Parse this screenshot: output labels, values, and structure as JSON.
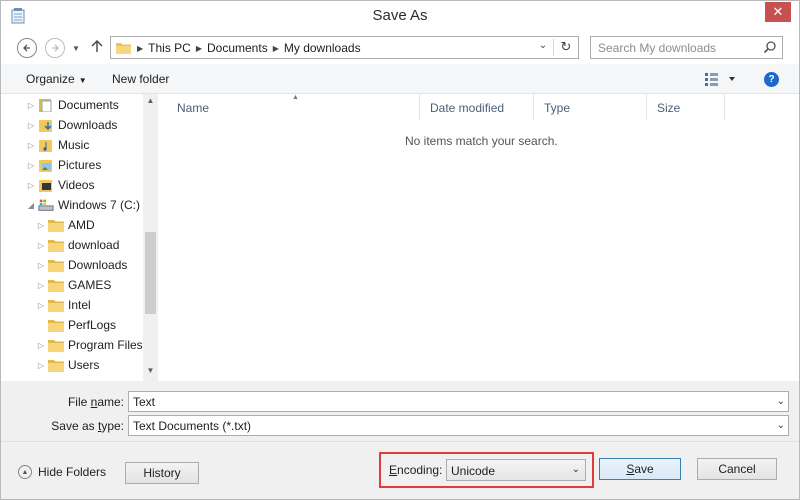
{
  "window": {
    "title": "Save As",
    "close": "✕"
  },
  "nav": {
    "crumbs": [
      "This PC",
      "Documents",
      "My downloads"
    ],
    "search_placeholder": "Search My downloads"
  },
  "toolbar": {
    "organize": "Organize",
    "new_folder": "New folder",
    "help": "?"
  },
  "tree": [
    {
      "label": "Documents",
      "arrow": "▷",
      "icon": "documents-icon"
    },
    {
      "label": "Downloads",
      "arrow": "▷",
      "icon": "downloads-icon"
    },
    {
      "label": "Music",
      "arrow": "▷",
      "icon": "music-icon"
    },
    {
      "label": "Pictures",
      "arrow": "▷",
      "icon": "pictures-icon"
    },
    {
      "label": "Videos",
      "arrow": "▷",
      "icon": "videos-icon"
    },
    {
      "label": "Windows 7 (C:)",
      "arrow": "◢",
      "icon": "drive-icon"
    },
    {
      "label": "AMD",
      "arrow": "▷",
      "icon": "folder-icon"
    },
    {
      "label": "download",
      "arrow": "▷",
      "icon": "folder-icon"
    },
    {
      "label": "Downloads",
      "arrow": "▷",
      "icon": "folder-icon"
    },
    {
      "label": "GAMES",
      "arrow": "▷",
      "icon": "folder-icon"
    },
    {
      "label": "Intel",
      "arrow": "▷",
      "icon": "folder-icon"
    },
    {
      "label": "PerfLogs",
      "arrow": "",
      "icon": "folder-icon"
    },
    {
      "label": "Program Files",
      "arrow": "▷",
      "icon": "folder-icon"
    },
    {
      "label": "Users",
      "arrow": "▷",
      "icon": "folder-icon"
    }
  ],
  "columns": [
    "Name",
    "Date modified",
    "Type",
    "Size"
  ],
  "empty_message": "No items match your search.",
  "form": {
    "filename_label_pre": "File ",
    "filename_label_ul": "n",
    "filename_label_post": "ame:",
    "filename_value": "Text",
    "savetype_label_pre": "Save as ",
    "savetype_label_ul": "t",
    "savetype_label_post": "ype:",
    "savetype_value": "Text Documents (*.txt)"
  },
  "footer": {
    "hide_folders": "Hide Folders",
    "history": "History",
    "encoding_label_ul": "E",
    "encoding_label_post": "ncoding:",
    "encoding_value": "Unicode",
    "save_ul": "S",
    "save_post": "ave",
    "cancel": "Cancel"
  },
  "colors": {
    "accent": "#1b6ac9",
    "highlight_border": "#e23b3b",
    "close": "#c75050"
  }
}
